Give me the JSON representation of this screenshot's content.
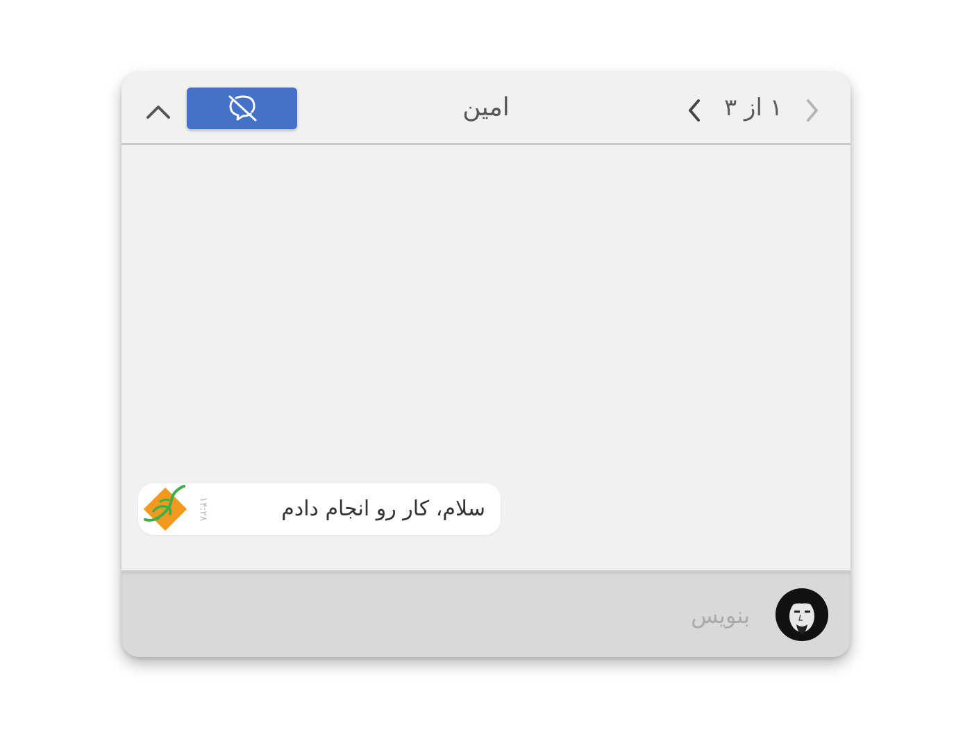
{
  "header": {
    "title": "امین",
    "pager": "۱ از ۳",
    "collapse_icon": "chevron-up-icon",
    "mute_icon": "chat-off-icon",
    "next_icon": "chevron-left-icon",
    "prev_icon": "chevron-right-icon",
    "mute_button_color": "#4472c8"
  },
  "messages": [
    {
      "text": "سلام، کار رو انجام دادم",
      "time": "۱۴:۲۸",
      "avatar": "sender-logo-avatar"
    }
  ],
  "composer": {
    "placeholder": "بنویس",
    "value": "",
    "avatar": "user-avatar"
  },
  "colors": {
    "window_bg": "#f1f1f1",
    "composer_bg": "#d9d9d9",
    "bubble_bg": "#ffffff",
    "logo_orange": "#f39a1e",
    "logo_green": "#3fae49"
  }
}
